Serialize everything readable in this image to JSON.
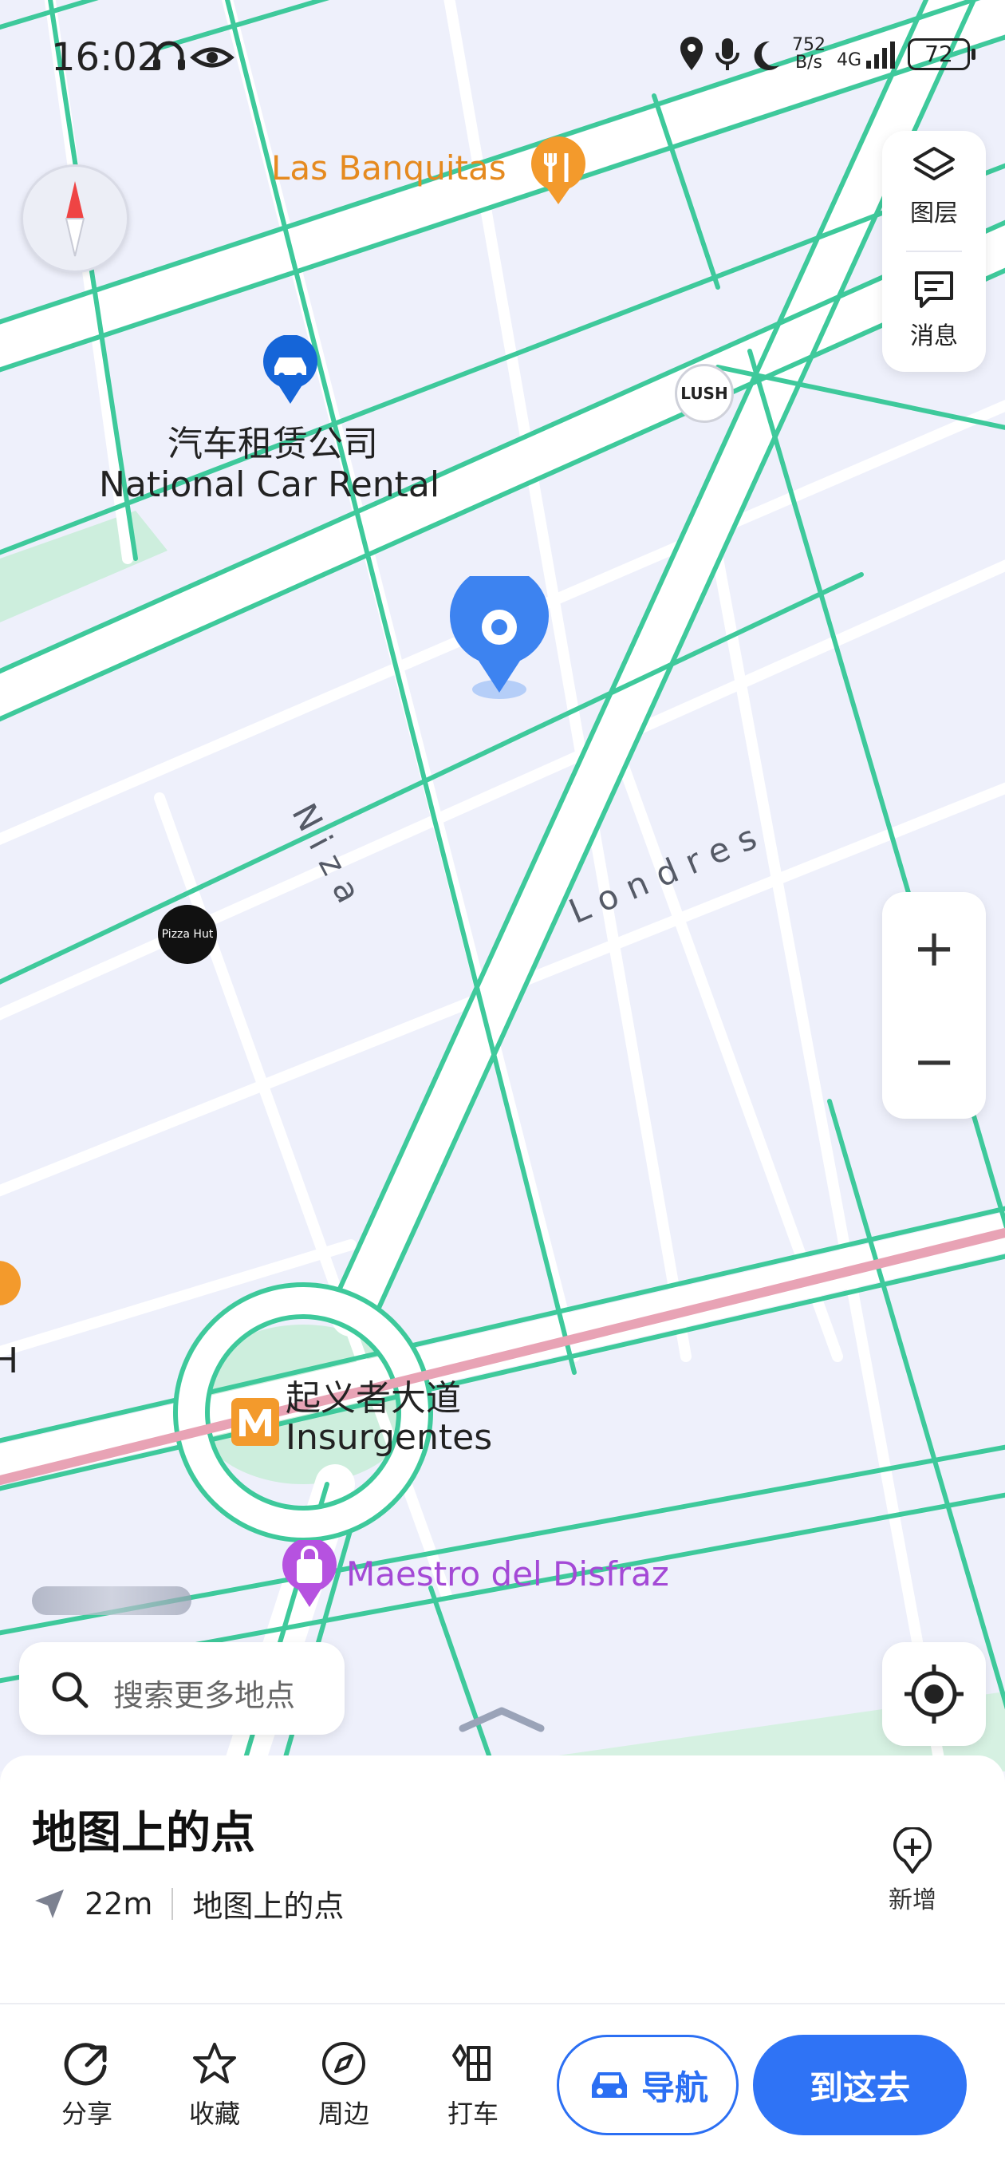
{
  "status_bar": {
    "time": "16:02",
    "net_speed_value": "752",
    "net_speed_unit": "B/s",
    "network": "4G",
    "battery": "72"
  },
  "map_controls": {
    "layers_label": "图层",
    "messages_label": "消息",
    "zoom_in_label": "+",
    "zoom_out_label": "−"
  },
  "map_labels": {
    "las_banquitas": "Las Banquitas",
    "car_rental_cn": "汽车租赁公司",
    "car_rental_en": "National Car Rental",
    "lush": "LUSH",
    "street_niza": "Niza",
    "street_londres": "Londres",
    "pizza_hut": "Pizza Hut",
    "metro_cn": "起义者大道",
    "metro_en": "Insurgentes",
    "maestro": "Maestro del Disfraz",
    "edge_h": "H"
  },
  "search": {
    "placeholder": "搜索更多地点"
  },
  "sheet": {
    "title": "地图上的点",
    "distance": "22m",
    "subtitle": "地图上的点",
    "add_label": "新增"
  },
  "actions": {
    "share": "分享",
    "favorite": "收藏",
    "nearby": "周边",
    "taxi": "打车",
    "navigate": "导航",
    "go_here": "到这去"
  },
  "colors": {
    "road_outline": "#3ec99b",
    "metro_line": "#e8a3b5",
    "accent_blue": "#2f73f5",
    "poi_orange": "#e58a1f",
    "poi_purple": "#a449d6"
  }
}
